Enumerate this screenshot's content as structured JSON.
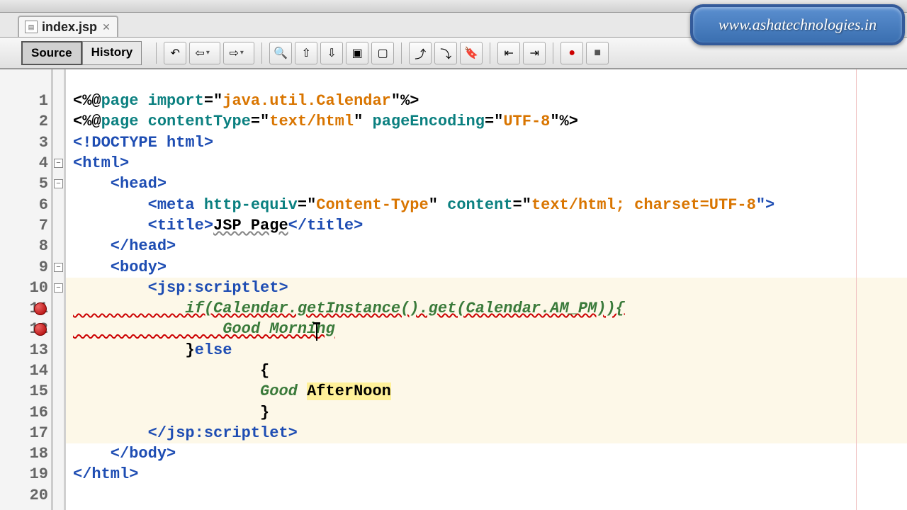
{
  "tab": {
    "filename": "index.jsp"
  },
  "view_tabs": {
    "source": "Source",
    "history": "History"
  },
  "watermark": "www.ashatechnologies.in",
  "code": {
    "l1_a": "<%@",
    "l1_b": "page ",
    "l1_c": "import",
    "l1_d": "=\"",
    "l1_e": "java.util.Calendar",
    "l1_f": "\"%>",
    "l2_a": "<%@",
    "l2_b": "page ",
    "l2_c": "contentType",
    "l2_d": "=\"",
    "l2_e": "text/html",
    "l2_f": "\" ",
    "l2_g": "pageEncoding",
    "l2_h": "=\"",
    "l2_i": "UTF-8",
    "l2_j": "\"%>",
    "l3": "<!DOCTYPE html>",
    "l4": "<html>",
    "l5": "    <head>",
    "l6_a": "        <meta ",
    "l6_b": "http-equiv",
    "l6_c": "=\"",
    "l6_d": "Content-Type",
    "l6_e": "\" ",
    "l6_f": "content",
    "l6_g": "=\"",
    "l6_h": "text/html; charset=UTF-8",
    "l6_i": "\">",
    "l7_a": "        <title>",
    "l7_b": "JSP Page",
    "l7_c": "</title>",
    "l8": "    </head>",
    "l9": "    <body>",
    "l10": "        <jsp:scriptlet>",
    "l11": "            if(Calendar.getInstance().get(Calendar.AM_PM)){",
    "l12_a": "                Good Morni",
    "l12_b": "ng",
    "l13_a": "            }",
    "l13_b": "else",
    "l14": "                    {",
    "l15_a": "                    ",
    "l15_b": "Good",
    "l15_c": " ",
    "l15_d": "AfterNoon",
    "l16": "                    }",
    "l17": "        </jsp:scriptlet>",
    "l18": "    </body>",
    "l19": "</html>"
  },
  "lines": {
    "count": 20
  },
  "errors": {
    "lines": [
      11,
      12
    ]
  },
  "folds": {
    "lines": [
      4,
      5,
      9,
      10
    ]
  }
}
